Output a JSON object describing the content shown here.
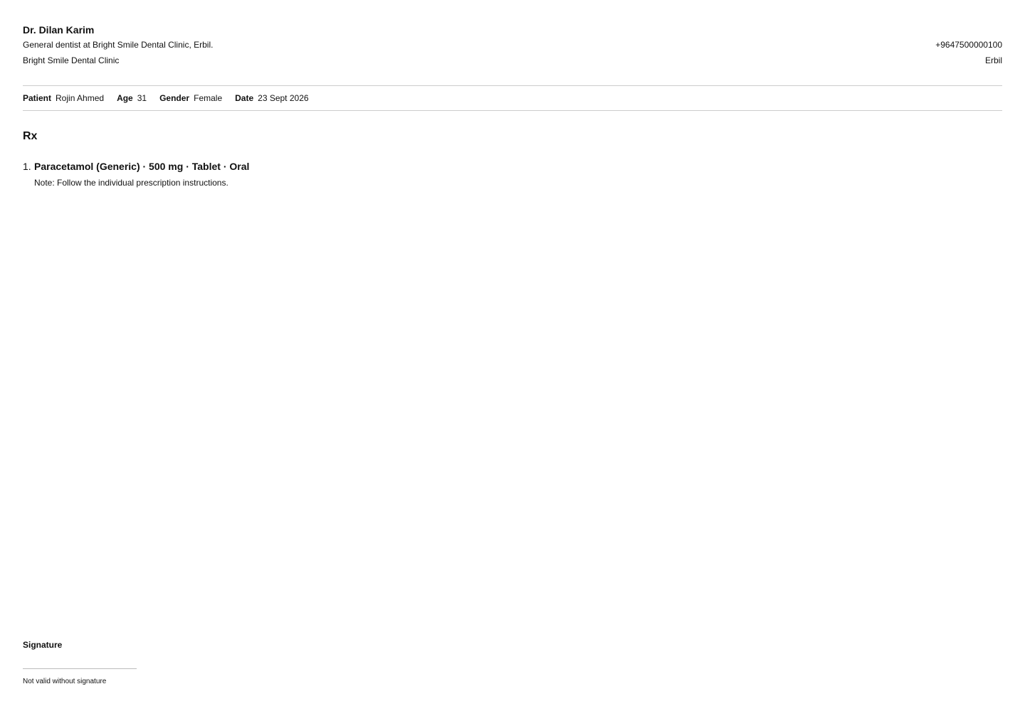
{
  "doctor": {
    "name": "Dr. Dilan Karim",
    "description": "General dentist at Bright Smile Dental Clinic, Erbil.",
    "clinic": "Bright Smile Dental Clinic",
    "phone": "+9647500000100",
    "city": "Erbil"
  },
  "patient": {
    "name_label": "Patient",
    "name": "Rojin Ahmed",
    "age_label": "Age",
    "age": "31",
    "gender_label": "Gender",
    "gender": "Female",
    "date_label": "Date",
    "date": "23 Sept 2026"
  },
  "rx": {
    "title": "Rx",
    "items": [
      {
        "number": "1.",
        "medication": "Paracetamol (Generic) · 500 mg · Tablet · Oral",
        "note": "Note: Follow the individual prescription instructions."
      }
    ]
  },
  "signature": {
    "label": "Signature",
    "note": "Not valid without signature"
  }
}
